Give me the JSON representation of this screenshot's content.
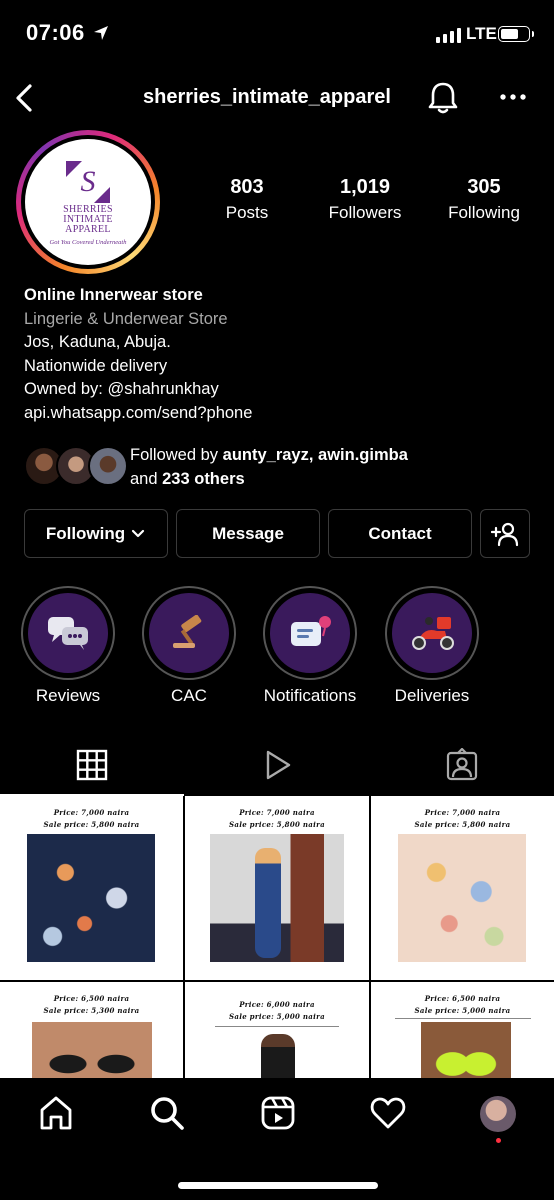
{
  "status_bar": {
    "time": "07:06",
    "network": "LTE"
  },
  "header": {
    "username": "sherries_intimate_apparel"
  },
  "avatar": {
    "brand_line1": "SHERRIES",
    "brand_line2": "INTIMATE",
    "brand_line3": "APPAREL",
    "tagline": "Got You Covered Underneath"
  },
  "stats": [
    {
      "value": "803",
      "label": "Posts"
    },
    {
      "value": "1,019",
      "label": "Followers"
    },
    {
      "value": "305",
      "label": "Following"
    }
  ],
  "bio": {
    "name": "Online Innerwear store",
    "category": "Lingerie & Underwear Store",
    "line1": "Jos, Kaduna, Abuja.",
    "line2": "Nationwide delivery",
    "line3": "Owned by: @shahrunkhay",
    "link": "api.whatsapp.com/send?phone"
  },
  "followed_by": {
    "prefix": "Followed by",
    "user1": "aunty_rayz",
    "user2": "awin.gimba",
    "and": "and",
    "others": "233 others"
  },
  "buttons": {
    "following": "Following",
    "message": "Message",
    "contact": "Contact"
  },
  "highlights": [
    {
      "label": "Reviews",
      "icon": "chat-bubbles-icon"
    },
    {
      "label": "CAC",
      "icon": "gavel-icon"
    },
    {
      "label": "Notifications",
      "icon": "notification-card-icon"
    },
    {
      "label": "Deliveries",
      "icon": "delivery-scooter-icon"
    }
  ],
  "posts": [
    {
      "price": "Price: 7,000 naira",
      "sale": "Sale price: 5,800 naira"
    },
    {
      "price": "Price: 7,000 naira",
      "sale": "Sale price: 5,800 naira"
    },
    {
      "price": "Price: 7,000 naira",
      "sale": "Sale price: 5,800 naira"
    },
    {
      "price": "Price: 6,500 naira",
      "sale": "Sale price: 5,300 naira"
    },
    {
      "price": "Price: 6,000 naira",
      "sale": "Sale price: 5,000 naira"
    },
    {
      "price": "Price: 6,500 naira",
      "sale": "Sale price: 5,000 naira"
    }
  ],
  "colors": {
    "accent_purple": "#6a2c8c",
    "highlight_bg": "#3a1a5c",
    "notification_dot": "#ff3040"
  }
}
